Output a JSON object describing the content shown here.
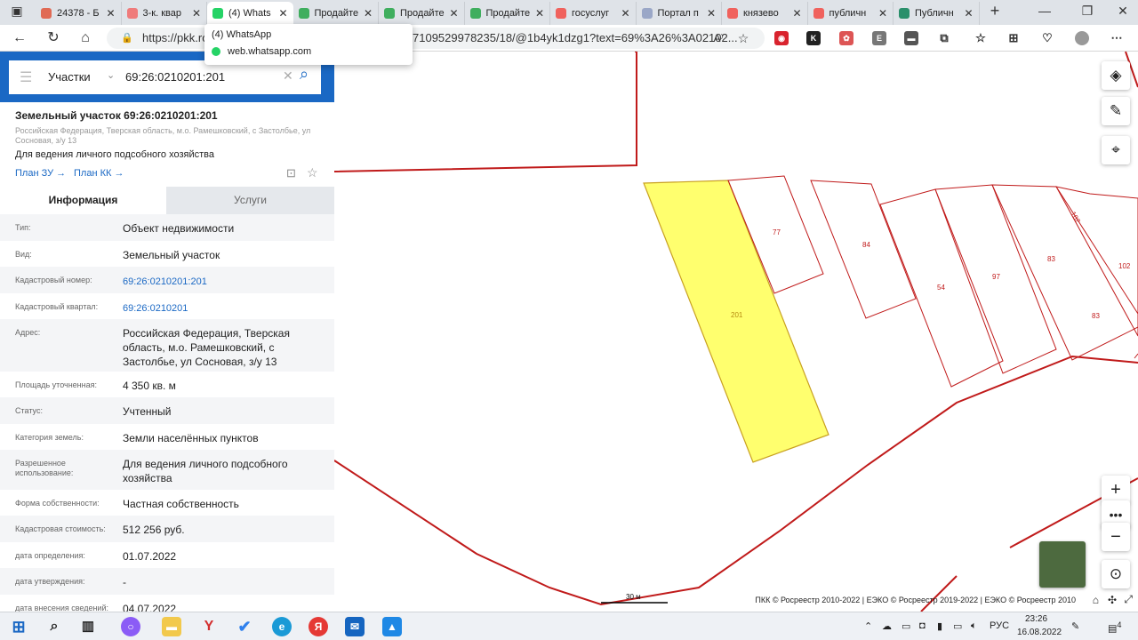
{
  "tabs": [
    {
      "title": "24378 - Б",
      "color": "#e06a54",
      "active": false
    },
    {
      "title": "3-к. квар",
      "color": "#ef7b7b",
      "active": false
    },
    {
      "title": "(4) Whats",
      "color": "#25d366",
      "active": true
    },
    {
      "title": "Продайте",
      "color": "#3fae5e",
      "active": false
    },
    {
      "title": "Продайте",
      "color": "#3fae5e",
      "active": false
    },
    {
      "title": "Продайте",
      "color": "#3fae5e",
      "active": false
    },
    {
      "title": "госуслуг",
      "color": "#f0625d",
      "active": false
    },
    {
      "title": "Портал п",
      "color": "#9aa7c7",
      "active": false
    },
    {
      "title": "князево",
      "color": "#f0625d",
      "active": false
    },
    {
      "title": "публичн",
      "color": "#f0625d",
      "active": false
    },
    {
      "title": "Публичн",
      "color": "#2a8f6b",
      "active": false
    }
  ],
  "address": {
    "url_start": "https://pkk.ro",
    "url_end": "7109529978235/18/@1b4yk1dzg1?text=69%3A26%3A02102..."
  },
  "tooltip": {
    "title": "(4) WhatsApp",
    "url": "web.whatsapp.com"
  },
  "search": {
    "type": "Участки",
    "query": "69:26:0210201:201"
  },
  "parcel": {
    "title": "Земельный участок 69:26:0210201:201",
    "address": "Российская Федерация, Тверская область, м.о. Рамешковский, с Застолбье, ул Сосновая, з/у 13",
    "use": "Для ведения личного подсобного хозяйства",
    "plan_zu": "План ЗУ →",
    "plan_kk": "План КК →"
  },
  "tabs_panel": {
    "info": "Информация",
    "services": "Услуги"
  },
  "fields": [
    {
      "k": "Тип:",
      "v": "Объект недвижимости",
      "link": false
    },
    {
      "k": "Вид:",
      "v": "Земельный участок",
      "link": false
    },
    {
      "k": "Кадастровый номер:",
      "v": "69:26:0210201:201",
      "link": true
    },
    {
      "k": "Кадастровый квартал:",
      "v": "69:26:0210201",
      "link": true
    },
    {
      "k": "Адрес:",
      "v": "Российская Федерация, Тверская область, м.о. Рамешковский, с Застолбье, ул Сосновая, з/у 13",
      "link": false
    },
    {
      "k": "Площадь уточненная:",
      "v": "4 350 кв. м",
      "link": false
    },
    {
      "k": "Статус:",
      "v": "Учтенный",
      "link": false
    },
    {
      "k": "Категория земель:",
      "v": "Земли населённых пунктов",
      "link": false
    },
    {
      "k": "Разрешенное использование:",
      "v": "Для ведения личного подсобного хозяйства",
      "link": false
    },
    {
      "k": "Форма собственности:",
      "v": "Частная собственность",
      "link": false
    },
    {
      "k": "Кадастровая стоимость:",
      "v": "512 256 руб.",
      "link": false
    },
    {
      "k": "дата определения:",
      "v": "01.07.2022",
      "link": false
    },
    {
      "k": "дата утверждения:",
      "v": "-",
      "link": false
    },
    {
      "k": "дата внесения сведений:",
      "v": "04.07.2022",
      "link": false
    }
  ],
  "map": {
    "labels": {
      "l201": "201",
      "l77": "77",
      "l84": "84",
      "l54": "54",
      "l97": "97",
      "l83a": "83",
      "l83b": "83",
      "l102a": "102",
      "l102b": "102"
    },
    "scale": "30 м",
    "attribution": "ПКК © Росреестр 2010-2022 | ЕЭКО © Росреестр 2019-2022 | ЕЭКО © Росреестр 2010"
  },
  "taskbar": {
    "lang": "РУС",
    "time": "23:26",
    "date": "16.08.2022",
    "notif": "4"
  }
}
